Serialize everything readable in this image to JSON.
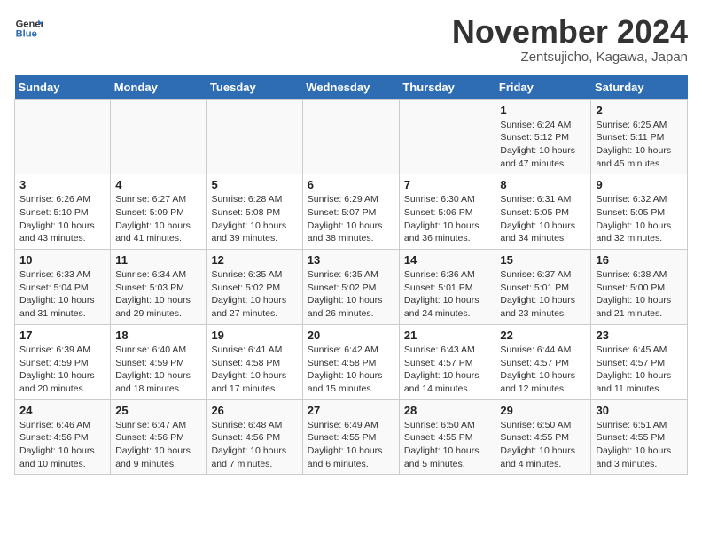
{
  "header": {
    "logo_line1": "General",
    "logo_line2": "Blue",
    "month": "November 2024",
    "location": "Zentsujicho, Kagawa, Japan"
  },
  "weekdays": [
    "Sunday",
    "Monday",
    "Tuesday",
    "Wednesday",
    "Thursday",
    "Friday",
    "Saturday"
  ],
  "weeks": [
    [
      {
        "day": "",
        "info": ""
      },
      {
        "day": "",
        "info": ""
      },
      {
        "day": "",
        "info": ""
      },
      {
        "day": "",
        "info": ""
      },
      {
        "day": "",
        "info": ""
      },
      {
        "day": "1",
        "info": "Sunrise: 6:24 AM\nSunset: 5:12 PM\nDaylight: 10 hours\nand 47 minutes."
      },
      {
        "day": "2",
        "info": "Sunrise: 6:25 AM\nSunset: 5:11 PM\nDaylight: 10 hours\nand 45 minutes."
      }
    ],
    [
      {
        "day": "3",
        "info": "Sunrise: 6:26 AM\nSunset: 5:10 PM\nDaylight: 10 hours\nand 43 minutes."
      },
      {
        "day": "4",
        "info": "Sunrise: 6:27 AM\nSunset: 5:09 PM\nDaylight: 10 hours\nand 41 minutes."
      },
      {
        "day": "5",
        "info": "Sunrise: 6:28 AM\nSunset: 5:08 PM\nDaylight: 10 hours\nand 39 minutes."
      },
      {
        "day": "6",
        "info": "Sunrise: 6:29 AM\nSunset: 5:07 PM\nDaylight: 10 hours\nand 38 minutes."
      },
      {
        "day": "7",
        "info": "Sunrise: 6:30 AM\nSunset: 5:06 PM\nDaylight: 10 hours\nand 36 minutes."
      },
      {
        "day": "8",
        "info": "Sunrise: 6:31 AM\nSunset: 5:05 PM\nDaylight: 10 hours\nand 34 minutes."
      },
      {
        "day": "9",
        "info": "Sunrise: 6:32 AM\nSunset: 5:05 PM\nDaylight: 10 hours\nand 32 minutes."
      }
    ],
    [
      {
        "day": "10",
        "info": "Sunrise: 6:33 AM\nSunset: 5:04 PM\nDaylight: 10 hours\nand 31 minutes."
      },
      {
        "day": "11",
        "info": "Sunrise: 6:34 AM\nSunset: 5:03 PM\nDaylight: 10 hours\nand 29 minutes."
      },
      {
        "day": "12",
        "info": "Sunrise: 6:35 AM\nSunset: 5:02 PM\nDaylight: 10 hours\nand 27 minutes."
      },
      {
        "day": "13",
        "info": "Sunrise: 6:35 AM\nSunset: 5:02 PM\nDaylight: 10 hours\nand 26 minutes."
      },
      {
        "day": "14",
        "info": "Sunrise: 6:36 AM\nSunset: 5:01 PM\nDaylight: 10 hours\nand 24 minutes."
      },
      {
        "day": "15",
        "info": "Sunrise: 6:37 AM\nSunset: 5:01 PM\nDaylight: 10 hours\nand 23 minutes."
      },
      {
        "day": "16",
        "info": "Sunrise: 6:38 AM\nSunset: 5:00 PM\nDaylight: 10 hours\nand 21 minutes."
      }
    ],
    [
      {
        "day": "17",
        "info": "Sunrise: 6:39 AM\nSunset: 4:59 PM\nDaylight: 10 hours\nand 20 minutes."
      },
      {
        "day": "18",
        "info": "Sunrise: 6:40 AM\nSunset: 4:59 PM\nDaylight: 10 hours\nand 18 minutes."
      },
      {
        "day": "19",
        "info": "Sunrise: 6:41 AM\nSunset: 4:58 PM\nDaylight: 10 hours\nand 17 minutes."
      },
      {
        "day": "20",
        "info": "Sunrise: 6:42 AM\nSunset: 4:58 PM\nDaylight: 10 hours\nand 15 minutes."
      },
      {
        "day": "21",
        "info": "Sunrise: 6:43 AM\nSunset: 4:57 PM\nDaylight: 10 hours\nand 14 minutes."
      },
      {
        "day": "22",
        "info": "Sunrise: 6:44 AM\nSunset: 4:57 PM\nDaylight: 10 hours\nand 12 minutes."
      },
      {
        "day": "23",
        "info": "Sunrise: 6:45 AM\nSunset: 4:57 PM\nDaylight: 10 hours\nand 11 minutes."
      }
    ],
    [
      {
        "day": "24",
        "info": "Sunrise: 6:46 AM\nSunset: 4:56 PM\nDaylight: 10 hours\nand 10 minutes."
      },
      {
        "day": "25",
        "info": "Sunrise: 6:47 AM\nSunset: 4:56 PM\nDaylight: 10 hours\nand 9 minutes."
      },
      {
        "day": "26",
        "info": "Sunrise: 6:48 AM\nSunset: 4:56 PM\nDaylight: 10 hours\nand 7 minutes."
      },
      {
        "day": "27",
        "info": "Sunrise: 6:49 AM\nSunset: 4:55 PM\nDaylight: 10 hours\nand 6 minutes."
      },
      {
        "day": "28",
        "info": "Sunrise: 6:50 AM\nSunset: 4:55 PM\nDaylight: 10 hours\nand 5 minutes."
      },
      {
        "day": "29",
        "info": "Sunrise: 6:50 AM\nSunset: 4:55 PM\nDaylight: 10 hours\nand 4 minutes."
      },
      {
        "day": "30",
        "info": "Sunrise: 6:51 AM\nSunset: 4:55 PM\nDaylight: 10 hours\nand 3 minutes."
      }
    ]
  ]
}
